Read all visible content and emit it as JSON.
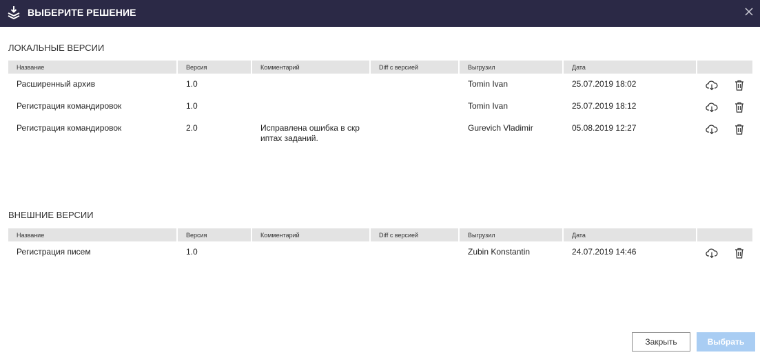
{
  "window": {
    "title": "ВЫБЕРИТЕ РЕШЕНИЕ"
  },
  "columns": [
    "Название",
    "Версия",
    "Комментарий",
    "Diff с версией",
    "Выгрузил",
    "Дата"
  ],
  "local": {
    "title": "ЛОКАЛЬНЫЕ ВЕРСИИ",
    "rows": [
      {
        "name": "Расширенный архив",
        "version": "1.0",
        "comment": "",
        "diff": "",
        "user": "Tomin Ivan",
        "date": "25.07.2019 18:02"
      },
      {
        "name": "Регистрация командировок",
        "version": "1.0",
        "comment": "",
        "diff": "",
        "user": "Tomin Ivan",
        "date": "25.07.2019 18:12"
      },
      {
        "name": "Регистрация командировок",
        "version": "2.0",
        "comment": "Исправлена ошибка в скр\nиптах заданий.",
        "diff": "",
        "user": "Gurevich Vladimir",
        "date": "05.08.2019 12:27"
      }
    ]
  },
  "external": {
    "title": "ВНЕШНИЕ ВЕРСИИ",
    "rows": [
      {
        "name": "Регистрация писем",
        "version": "1.0",
        "comment": "",
        "diff": "",
        "user": "Zubin Konstantin",
        "date": "24.07.2019 14:46"
      }
    ]
  },
  "icons": {
    "title": "download-stack-icon",
    "close": "close-icon",
    "download": "cloud-download-icon",
    "delete": "trash-icon"
  },
  "colors": {
    "titlebar": "#2b2946",
    "header_cell": "#e3e3e3",
    "primary_disabled": "#a9cdf3"
  },
  "buttons": {
    "close": "Закрыть",
    "select": "Выбрать"
  }
}
